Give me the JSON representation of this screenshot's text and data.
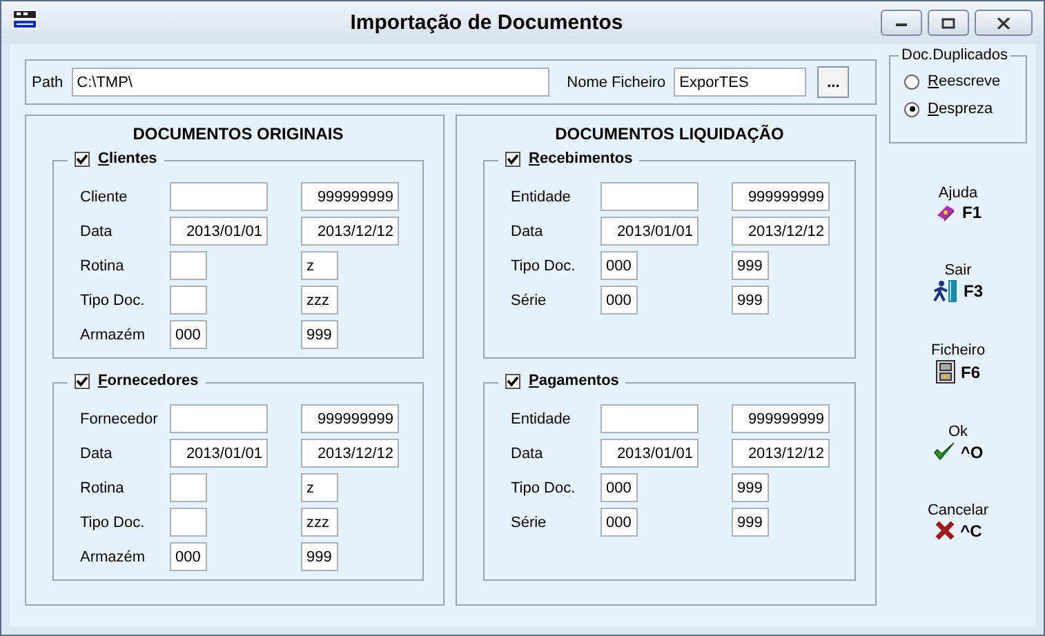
{
  "window": {
    "title": "Importação de Documentos"
  },
  "path_bar": {
    "path_label": "Path",
    "path_value": "C:\\TMP\\",
    "file_label": "Nome Ficheiro",
    "file_value": "ExporTES",
    "browse_button": "..."
  },
  "duplicates": {
    "title": "Doc.Duplicados",
    "options": [
      {
        "label": "Reescreve",
        "selected": false
      },
      {
        "label": "Despreza",
        "selected": true
      }
    ]
  },
  "panels": [
    {
      "title": "DOCUMENTOS ORIGINAIS",
      "groups": [
        {
          "label": "Clientes",
          "checked": true,
          "rows": [
            {
              "label": "Cliente",
              "kind": "wide",
              "to": "999999999"
            },
            {
              "label": "Data",
              "kind": "wide",
              "from": "2013/01/01",
              "to": "2013/12/12"
            },
            {
              "label": "Rotina",
              "kind": "short",
              "to": "z"
            },
            {
              "label": "Tipo Doc.",
              "kind": "short",
              "to": "zzz"
            },
            {
              "label": "Armazém",
              "kind": "short",
              "from": "000",
              "to": "999"
            }
          ]
        },
        {
          "label": "Fornecedores",
          "checked": true,
          "rows": [
            {
              "label": "Fornecedor",
              "kind": "wide",
              "to": "999999999"
            },
            {
              "label": "Data",
              "kind": "wide",
              "from": "2013/01/01",
              "to": "2013/12/12"
            },
            {
              "label": "Rotina",
              "kind": "short",
              "to": "z"
            },
            {
              "label": "Tipo Doc.",
              "kind": "short",
              "to": "zzz"
            },
            {
              "label": "Armazém",
              "kind": "short",
              "from": "000",
              "to": "999"
            }
          ]
        }
      ]
    },
    {
      "title": "DOCUMENTOS LIQUIDAÇÃO",
      "groups": [
        {
          "label": "Recebimentos",
          "checked": true,
          "rows": [
            {
              "label": "Entidade",
              "kind": "wide",
              "to": "999999999"
            },
            {
              "label": "Data",
              "kind": "wide",
              "from": "2013/01/01",
              "to": "2013/12/12"
            },
            {
              "label": "Tipo Doc.",
              "kind": "short",
              "from": "000",
              "to": "999"
            },
            {
              "label": "Série",
              "kind": "short",
              "from": "000",
              "to": "999"
            }
          ]
        },
        {
          "label": "Pagamentos",
          "checked": true,
          "rows": [
            {
              "label": "Entidade",
              "kind": "wide",
              "to": "999999999"
            },
            {
              "label": "Data",
              "kind": "wide",
              "from": "2013/01/01",
              "to": "2013/12/12"
            },
            {
              "label": "Tipo Doc.",
              "kind": "short",
              "from": "000",
              "to": "999"
            },
            {
              "label": "Série",
              "kind": "short",
              "from": "000",
              "to": "999"
            }
          ]
        }
      ]
    }
  ],
  "shortcuts": [
    {
      "kind": "help",
      "label": "Ajuda",
      "key": "F1"
    },
    {
      "kind": "exit",
      "label": "Sair",
      "key": "F3"
    },
    {
      "kind": "file",
      "label": "Ficheiro",
      "key": "F6"
    },
    {
      "kind": "ok",
      "label": "Ok",
      "key": "^O"
    },
    {
      "kind": "cancel",
      "label": "Cancelar",
      "key": "^C"
    }
  ]
}
